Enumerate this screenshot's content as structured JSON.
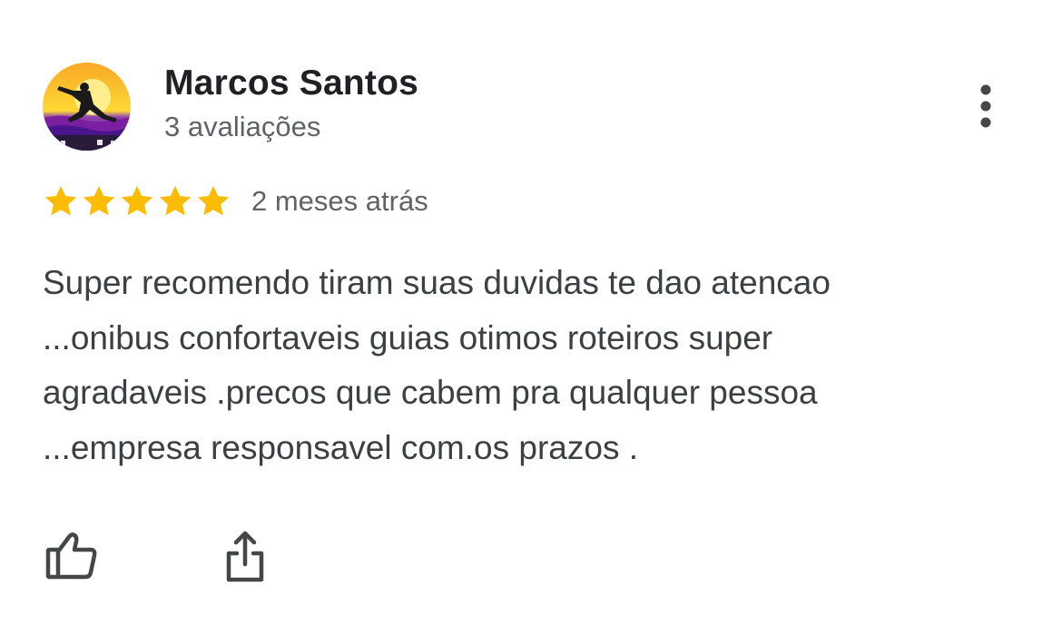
{
  "review": {
    "author": {
      "name": "Marcos Santos",
      "meta": "3 avaliações",
      "avatar_icon": "martial-arts-silhouette-avatar"
    },
    "rating": 5,
    "rating_max": 5,
    "date": "2 meses atrás",
    "text_lines": [
      "Super recomendo tiram suas duvidas te dao atencao",
      "...onibus confortaveis guias otimos roteiros super",
      "agradaveis .precos que cabem pra qualquer pessoa",
      "...empresa responsavel com.os prazos ."
    ],
    "actions": {
      "like_icon": "thumbs-up-icon",
      "share_icon": "share-icon",
      "more_icon": "more-vert-icon"
    }
  },
  "colors": {
    "star": "#FBBC04",
    "name": "#202124",
    "secondary": "#5f6368",
    "body": "#3c4043",
    "icon": "#444746"
  }
}
